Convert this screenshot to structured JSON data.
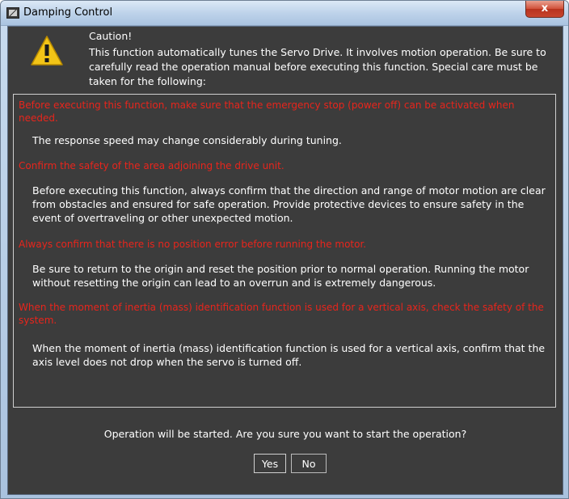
{
  "window": {
    "title": "Damping Control",
    "close_label": "x"
  },
  "caution": {
    "title": "Caution!",
    "body": "This function automatically tunes the Servo Drive. It involves motion operation. Be sure to carefully read the operation manual before executing this function. Special care must be taken for the following:",
    "icon": "warning-triangle-icon"
  },
  "items": [
    {
      "heading": "Before executing this function, make sure that the emergency stop (power off) can be activated when needed.",
      "text": "The response speed may change considerably during tuning."
    },
    {
      "heading": "Confirm the safety of the area adjoining the drive unit.",
      "text": "Before executing this function, always confirm that the direction and range of motor motion are clear from obstacles and ensured for safe operation. Provide protective devices to ensure safety in the event of overtraveling or other unexpected motion."
    },
    {
      "heading": "Always confirm that there is no position error before running the motor.",
      "text": "Be sure to return to the origin and reset the position prior to normal operation. Running the motor without resetting the origin can lead to an overrun and is extremely dangerous."
    },
    {
      "heading": "When the moment of inertia (mass) identification function is used for a vertical axis, check the safety of the system.",
      "text": "When the moment of inertia (mass) identification function is used for a vertical axis, confirm that the axis level does not drop when the servo is turned off."
    }
  ],
  "question": "Operation will be started. Are you sure you want to start the operation?",
  "buttons": {
    "yes": "Yes",
    "no": "No"
  },
  "colors": {
    "background": "#3c3c3c",
    "warning_text": "#e8251c",
    "body_text": "#ffffff",
    "warning_icon": "#f2c417"
  }
}
